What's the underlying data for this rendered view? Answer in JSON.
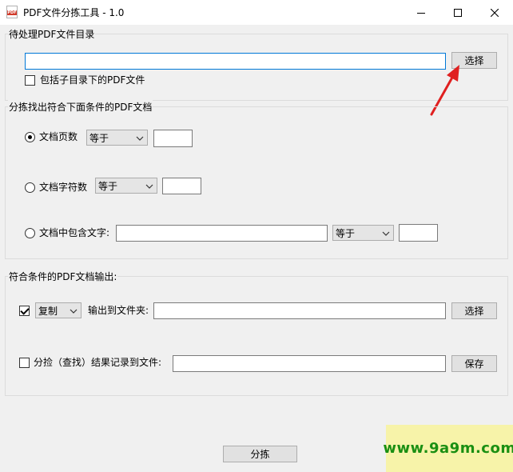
{
  "window": {
    "title": "PDF文件分拣工具 - 1.0",
    "app_icon_text": "PDF"
  },
  "source": {
    "group_title": "待处理PDF文件目录",
    "path_value": "",
    "browse_label": "选择",
    "include_subdirs_label": "包括子目录下的PDF文件",
    "include_subdirs_checked": false
  },
  "criteria": {
    "group_title": "分拣找出符合下面条件的PDF文档",
    "page_count": {
      "label": "文档页数",
      "operator": "等于",
      "value": "",
      "selected": true
    },
    "char_count": {
      "label": "文档字符数",
      "operator": "等于",
      "value": "",
      "selected": false
    },
    "contains_text": {
      "label": "文档中包含文字:",
      "text": "",
      "operator": "等于",
      "value": "",
      "selected": false
    }
  },
  "output": {
    "group_title": "符合条件的PDF文档输出:",
    "enabled": true,
    "action": "复制",
    "folder_label": "输出到文件夹:",
    "folder_value": "",
    "browse_label": "选择",
    "log_label": "分捡（查找）结果记录到文件:",
    "log_checked": false,
    "log_value": "",
    "save_label": "保存"
  },
  "run_label": "分拣",
  "watermark": "www.9a9m.com"
}
